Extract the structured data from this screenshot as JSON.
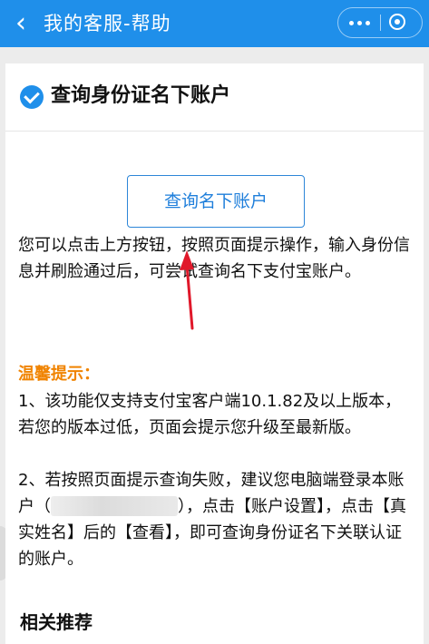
{
  "navbar": {
    "back_icon": "chevron-left-icon",
    "title": "我的客服-帮助",
    "more_icon": "more-dots-icon",
    "close_icon": "close-circle-icon",
    "color": "#1f8fea"
  },
  "article": {
    "title": "查询身份证名下账户",
    "title_icon": "check-circle-icon",
    "action_button": "查询名下账户",
    "intro": "您可以点击上方按钮，按照页面提示操作，输入身份信息并刷脸通过后，可尝试查询名下支付宝账户。",
    "tip_title": "温馨提示：",
    "tip_1": "1、该功能仅支持支付宝客户端10.1.82及以上版本，若您的版本过低，页面会提示您升级至最新版。",
    "tip_2_before": "2、若按照页面提示查询失败，建议您电脑端登录本账户（",
    "tip_2_after": "），点击【账户设置】，点击【真实姓名】后的【查看】，即可查询身份证名下关联认证的账户。",
    "accent_color": "#f08300"
  },
  "related": {
    "title": "相关推荐"
  }
}
